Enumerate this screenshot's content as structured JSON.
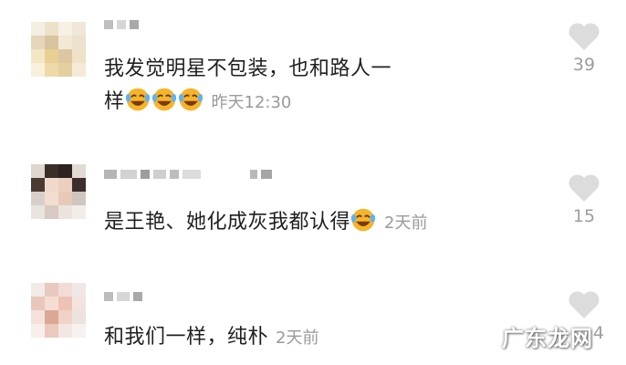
{
  "comments": [
    {
      "text_line1": "我发觉明星不包装，也和路人一",
      "text_line2": "样",
      "time": "昨天12:30",
      "like_count": "39",
      "emoji_count": 3
    },
    {
      "text": "是王艳、她化成灰我都认得",
      "time": "2天前",
      "like_count": "15",
      "emoji_count": 1
    },
    {
      "text": "和我们一样，纯朴",
      "time": "2天前",
      "like_count": "4",
      "emoji_count": 0
    }
  ],
  "watermark": "广东龙网",
  "icons": {
    "like": "heart-icon",
    "emoji": "laughing-tears-emoji"
  },
  "colors": {
    "text": "#1f1f1f",
    "meta": "#9a9a9a",
    "heart": "#dcdcdc",
    "emoji": "#f6b42a"
  }
}
